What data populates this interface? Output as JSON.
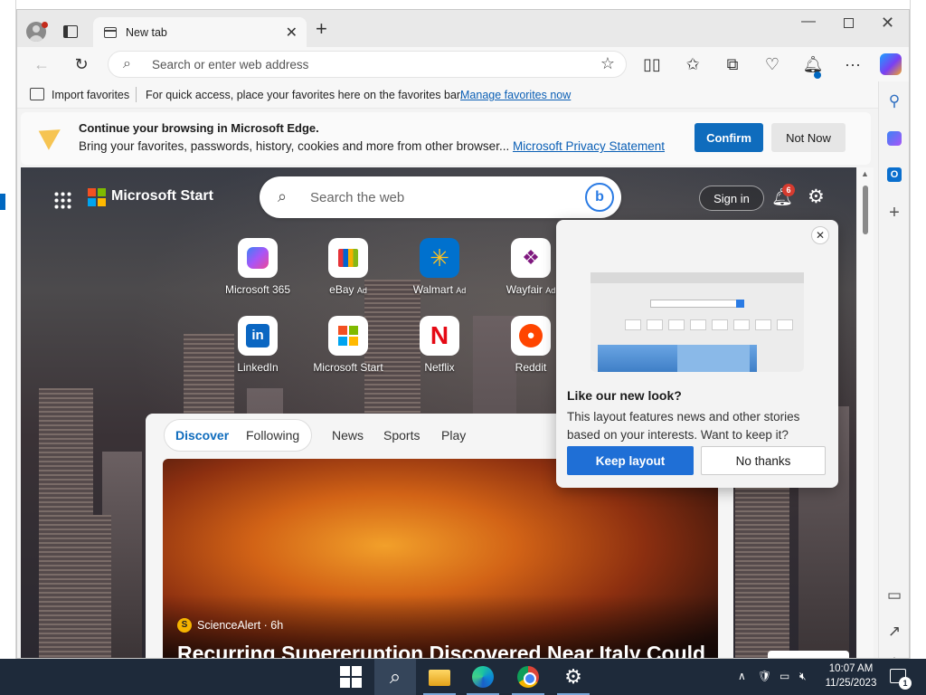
{
  "browser": {
    "tab_title": "New tab",
    "tab_close": "✕",
    "new_tab": "+",
    "address_placeholder": "Search or enter web address"
  },
  "favorites_bar": {
    "import_label": "Import favorites",
    "message": "For quick access, place your favorites here on the favorites bar.",
    "link": "Manage favorites now"
  },
  "infobar": {
    "title": "Continue your browsing in Microsoft Edge.",
    "text": "Bring your favorites, passwords, history, cookies and more from other browser...",
    "link": "Microsoft Privacy Statement",
    "confirm": "Confirm",
    "not_now": "Not Now"
  },
  "start_page": {
    "brand": "Microsoft Start",
    "search_placeholder": "Search the web",
    "sign_in": "Sign in",
    "notification_count": "6",
    "tiles_row1": [
      {
        "label": "Microsoft 365",
        "ad": ""
      },
      {
        "label": "eBay",
        "ad": "Ad"
      },
      {
        "label": "Walmart",
        "ad": "Ad"
      },
      {
        "label": "Wayfair",
        "ad": "Ad"
      }
    ],
    "tiles_row2": [
      {
        "label": "LinkedIn"
      },
      {
        "label": "Microsoft Start"
      },
      {
        "label": "Netflix"
      },
      {
        "label": "Reddit"
      }
    ]
  },
  "feed": {
    "tabs": [
      "Discover",
      "Following",
      "News",
      "Sports",
      "Play"
    ],
    "source": "ScienceAlert · 6h",
    "headline": "Recurring Supereruption Discovered Near Italy Could"
  },
  "layout_popup": {
    "close": "✕",
    "title": "Like our new look?",
    "text": "This layout features news and other stories based on your interests. Want to keep it?",
    "keep": "Keep layout",
    "no_thanks": "No thanks"
  },
  "taskbar": {
    "time": "10:07 AM",
    "date": "11/25/2023",
    "notification_count": "1"
  },
  "colors": {
    "accent": "#0f6cbd",
    "taskbar": "#1e2a3a"
  }
}
